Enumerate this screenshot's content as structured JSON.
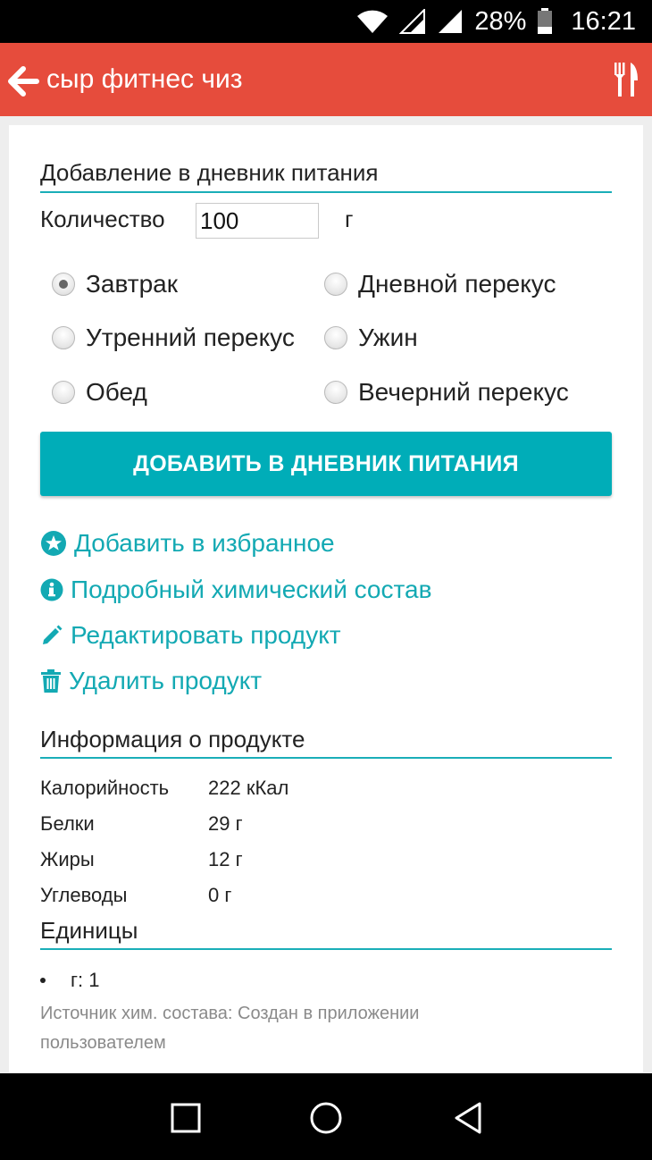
{
  "status_bar": {
    "battery": "28%",
    "time": "16:21"
  },
  "app_bar": {
    "title": "сыр фитнес чиз"
  },
  "diary": {
    "title": "Добавление в дневник питания",
    "quantity_label": "Количество",
    "quantity_value": "100",
    "quantity_unit": "г",
    "meals": [
      {
        "label": "Завтрак",
        "checked": true
      },
      {
        "label": "Дневной перекус",
        "checked": false
      },
      {
        "label": "Утренний перекус",
        "checked": false
      },
      {
        "label": "Ужин",
        "checked": false
      },
      {
        "label": "Обед",
        "checked": false
      },
      {
        "label": "Вечерний перекус",
        "checked": false
      }
    ],
    "add_button": "ДОБАВИТЬ В ДНЕВНИК ПИТАНИЯ"
  },
  "actions": [
    {
      "label": "Добавить в избранное",
      "icon": "star-icon"
    },
    {
      "label": "Подробный химический состав",
      "icon": "info-icon"
    },
    {
      "label": "Редактировать продукт",
      "icon": "pencil-icon"
    },
    {
      "label": "Удалить продукт",
      "icon": "trash-icon"
    }
  ],
  "product_info": {
    "title": "Информация о продукте",
    "rows": [
      {
        "name": "Калорийность",
        "value": "222 кКал"
      },
      {
        "name": "Белки",
        "value": "29 г"
      },
      {
        "name": "Жиры",
        "value": "12 г"
      },
      {
        "name": "Углеводы",
        "value": "0 г"
      }
    ]
  },
  "units": {
    "title": "Единицы",
    "items": [
      "г: 1"
    ],
    "source": "Источник хим. состава: Создан в приложении пользователем"
  },
  "colors": {
    "app_bar": "#e64c3c",
    "accent": "#00adb8",
    "link": "#13a9b3"
  }
}
